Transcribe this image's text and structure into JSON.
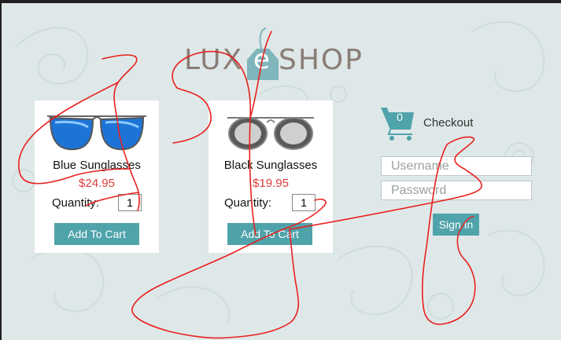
{
  "logo": {
    "left_text": "LUX",
    "tag_letter": "e",
    "right_text": "SHOP"
  },
  "products": [
    {
      "name": "Blue Sunglasses",
      "price": "$24.95",
      "quantity_label": "Quantity:",
      "quantity_value": "1",
      "button_label": "Add To Cart"
    },
    {
      "name": "Black Sunglasses",
      "price": "$19.95",
      "quantity_label": "Quantity:",
      "quantity_value": "1",
      "button_label": "Add To Cart"
    }
  ],
  "cart": {
    "count": "0",
    "checkout_label": "Checkout"
  },
  "login": {
    "username_placeholder": "Username",
    "password_placeholder": "Password",
    "signin_label": "Sign In"
  },
  "colors": {
    "accent": "#4fa3aa",
    "price": "#e23b3b",
    "scribble": "#e8201e"
  }
}
